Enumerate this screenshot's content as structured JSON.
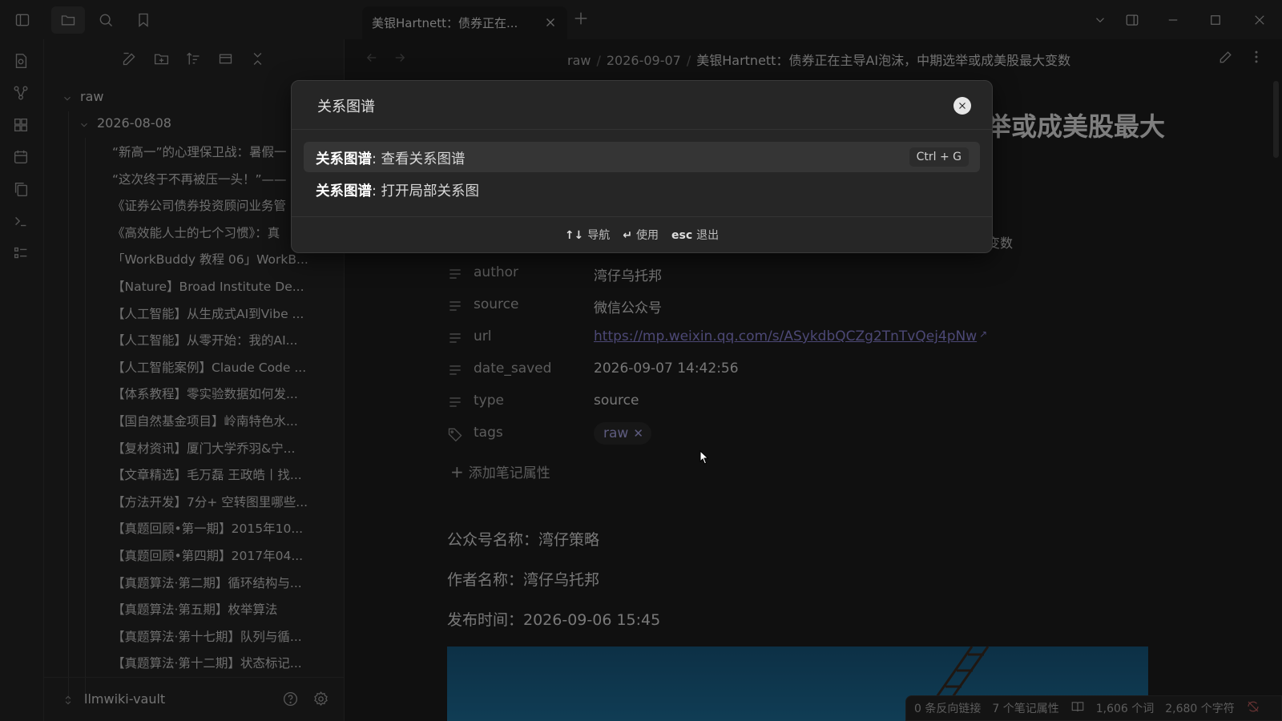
{
  "tab": {
    "title": "美银Hartnett：债券正在..."
  },
  "breadcrumb": [
    "raw",
    "2026-09-07",
    "美银Hartnett：债券正在主导AI泡沫，中期选举或成美股最大变数"
  ],
  "sidebar": {
    "root_folder": "raw",
    "sub_folder": "2026-08-08",
    "files": [
      "“新高一”的心理保卫战：暑假一",
      "“这次终于不再被压一头！”——",
      "《证券公司债券投资顾问业务管",
      "《高效能人士的七个习惯》：真",
      "「WorkBuddy 教程 06」WorkB...",
      "【Nature】Broad Institute De...",
      "【人工智能】从生成式AI到Vibe ...",
      "【人工智能】从零开始：我的AI...",
      "【人工智能案例】Claude Code ...",
      "【体系教程】零实验数据如何发...",
      "【国自然基金项目】岭南特色水...",
      "【复材资讯】厦门大学乔羽&宁...",
      "【文章精选】毛万磊 王政皓丨找...",
      "【方法开发】7分+ 空转图里哪些...",
      "【真题回顾•第一期】2015年10...",
      "【真题回顾•第四期】2017年04...",
      "【真题算法·第二期】循环结构与...",
      "【真题算法·第五期】枚举算法",
      "【真题算法·第十七期】队列与循...",
      "【真题算法·第十二期】状态标记..."
    ],
    "vault": "llmwiki-vault"
  },
  "note": {
    "title_partial": "举或成美股最大",
    "title_tail_partial": "变数",
    "properties": [
      {
        "key": "author",
        "value": "湾仔乌托邦",
        "icon": "text-lines-icon"
      },
      {
        "key": "source",
        "value": "微信公众号",
        "icon": "text-lines-icon"
      },
      {
        "key": "url",
        "value": "https://mp.weixin.qq.com/s/ASykdbQCZg2TnTvQej4pNw",
        "icon": "text-lines-icon"
      },
      {
        "key": "date_saved",
        "value": "2026-09-07 14:42:56",
        "icon": "text-lines-icon"
      },
      {
        "key": "type",
        "value": "source",
        "icon": "text-lines-icon"
      },
      {
        "key": "tags",
        "value": "raw",
        "icon": "tag-icon"
      }
    ],
    "add_property": "添加笔记属性",
    "body": [
      "公众号名称：湾仔策略",
      "作者名称：湾仔乌托邦",
      "发布时间：2026-09-06 15:45"
    ]
  },
  "palette": {
    "query": "关系图谱",
    "suggestions": [
      {
        "prefix": "关系图谱",
        "rest": ": 查看关系图谱",
        "hotkey": "Ctrl + G"
      },
      {
        "prefix": "关系图谱",
        "rest": ": 打开局部关系图",
        "hotkey": ""
      }
    ],
    "footer": [
      {
        "key": "↑↓",
        "label": "导航"
      },
      {
        "key": "↵",
        "label": "使用"
      },
      {
        "key": "esc",
        "label": "退出"
      }
    ]
  },
  "status": {
    "backlinks": "0 条反向链接",
    "properties": "7 个笔记属性",
    "words": "1,606 个词",
    "chars": "2,680 个字符"
  },
  "colors": {
    "accent": "#8a83d6",
    "background": "#1e1e1e",
    "panel": "#262626"
  }
}
